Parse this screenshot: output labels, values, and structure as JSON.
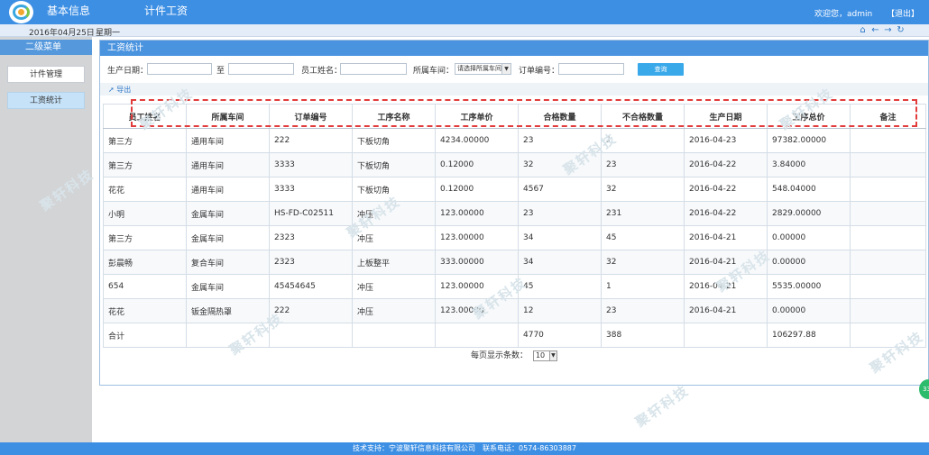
{
  "topbar": {
    "nav_basic": "基本信息",
    "nav_salary": "计件工资",
    "welcome": "欢迎您，admin",
    "logout": "【退出】"
  },
  "subbar": {
    "date": "2016年04月25日",
    "weekday": "星期一",
    "icons": [
      "home-icon",
      "back-icon",
      "forward-icon",
      "refresh-icon"
    ]
  },
  "sidebar": {
    "title": "二级菜单",
    "items": [
      {
        "label": "计件管理"
      },
      {
        "label": "工资统计"
      }
    ]
  },
  "main": {
    "title": "工资统计"
  },
  "filter": {
    "production_date_label": "生产日期：",
    "to_label": "至",
    "employee_label": "员工姓名：",
    "workshop_label": "所属车间：",
    "workshop_selected": "请选择所属车间",
    "order_label": "订单编号：",
    "search_label": "查询"
  },
  "export_label": "导出",
  "table": {
    "headers": [
      "员工姓名",
      "所属车间",
      "订单编号",
      "工序名称",
      "工序单价",
      "合格数量",
      "不合格数量",
      "生产日期",
      "工序总价",
      "备注"
    ],
    "rows": [
      [
        "第三方",
        "通用车间",
        "222",
        "下板切角",
        "4234.00000",
        "23",
        "1",
        "2016-04-23",
        "97382.00000",
        ""
      ],
      [
        "第三方",
        "通用车间",
        "3333",
        "下板切角",
        "0.12000",
        "32",
        "23",
        "2016-04-22",
        "3.84000",
        ""
      ],
      [
        "花花",
        "通用车间",
        "3333",
        "下板切角",
        "0.12000",
        "4567",
        "32",
        "2016-04-22",
        "548.04000",
        ""
      ],
      [
        "小明",
        "金属车间",
        "HS-FD-C02511",
        "冲压",
        "123.00000",
        "23",
        "231",
        "2016-04-22",
        "2829.00000",
        ""
      ],
      [
        "第三方",
        "金属车间",
        "2323",
        "冲压",
        "123.00000",
        "34",
        "45",
        "2016-04-21",
        "0.00000",
        ""
      ],
      [
        "彭晨畅",
        "复合车间",
        "2323",
        "上板整平",
        "333.00000",
        "34",
        "32",
        "2016-04-21",
        "0.00000",
        ""
      ],
      [
        "654",
        "金属车间",
        "45454645",
        "冲压",
        "123.00000",
        "45",
        "1",
        "2016-04-21",
        "5535.00000",
        ""
      ],
      [
        "花花",
        "钣金隔热罩",
        "222",
        "冲压",
        "123.00000",
        "12",
        "23",
        "2016-04-21",
        "0.00000",
        ""
      ],
      [
        "合计",
        "",
        "",
        "",
        "",
        "4770",
        "388",
        "",
        "106297.88",
        ""
      ]
    ]
  },
  "pager": {
    "label": "每页显示条数：",
    "page_size": "10"
  },
  "footer": "技术支持：宁波聚轩信息科技有限公司　联系电话：0574-86303887",
  "float_button": "33",
  "watermark": "聚轩科技"
}
